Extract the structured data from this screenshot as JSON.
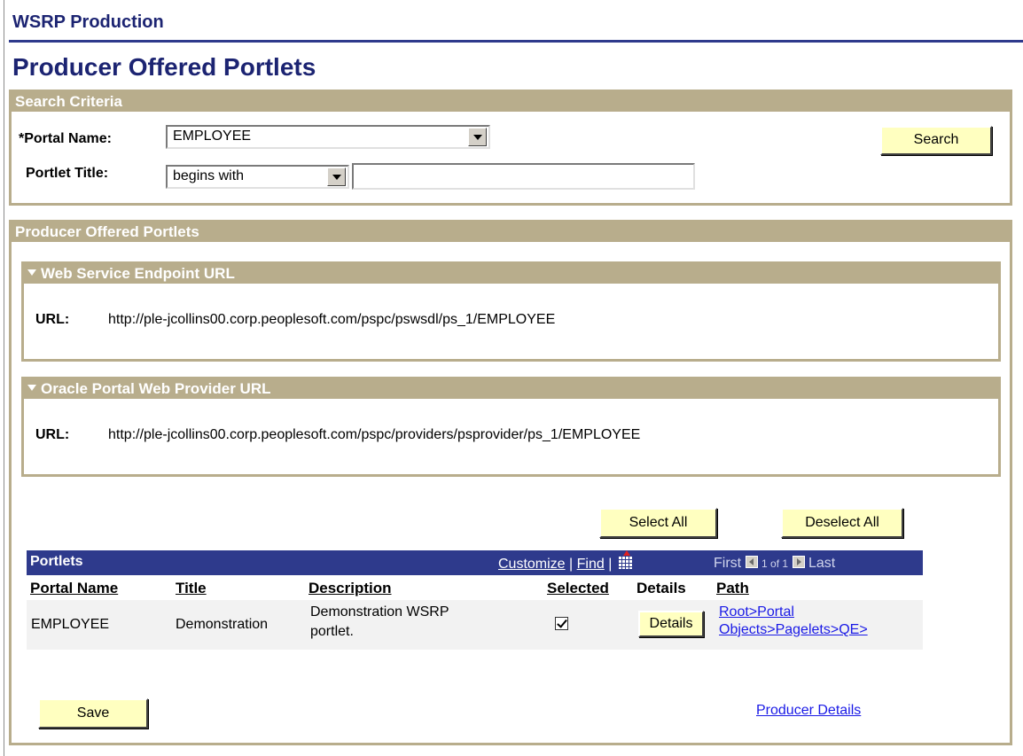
{
  "app_title": "WSRP Production",
  "page_title": "Producer Offered Portlets",
  "search": {
    "header": "Search Criteria",
    "portal_name_label": "*Portal Name:",
    "portal_name_value": "EMPLOYEE",
    "portlet_title_label": "Portlet Title:",
    "operator_value": "begins with",
    "title_value": "",
    "search_button": "Search"
  },
  "portlets_section": {
    "header": "Producer Offered Portlets",
    "web_service": {
      "header": "Web Service Endpoint URL",
      "url_label": "URL:",
      "url": "http://ple-jcollins00.corp.peoplesoft.com/pspc/pswsdl/ps_1/EMPLOYEE"
    },
    "oracle_portal": {
      "header": "Oracle Portal Web Provider URL",
      "url_label": "URL:",
      "url": "http://ple-jcollins00.corp.peoplesoft.com/pspc/providers/psprovider/ps_1/EMPLOYEE"
    },
    "select_all": "Select All",
    "deselect_all": "Deselect All"
  },
  "grid": {
    "title": "Portlets",
    "customize": "Customize",
    "sep": "|",
    "find": "Find",
    "first": "First",
    "page_info": "1 of 1",
    "last": "Last",
    "columns": {
      "portal_name": "Portal Name",
      "title": "Title",
      "description": "Description",
      "selected": "Selected",
      "details": "Details",
      "path": "Path"
    },
    "rows": [
      {
        "portal_name": "EMPLOYEE",
        "title": "Demonstration",
        "description_line1": "Demonstration WSRP",
        "description_line2": "portlet.",
        "selected": true,
        "details_button": "Details",
        "path_line1": "Root>Portal",
        "path_line2": "Objects>Pagelets>QE>"
      }
    ]
  },
  "save_button": "Save",
  "producer_details_link": "Producer Details",
  "colors": {
    "title_blue": "#1c2472",
    "box_tan": "#b8ad8c",
    "grid_header": "#2e3a8c",
    "button_yellow": "#ffffc0",
    "link_blue": "#1a1ae6"
  }
}
